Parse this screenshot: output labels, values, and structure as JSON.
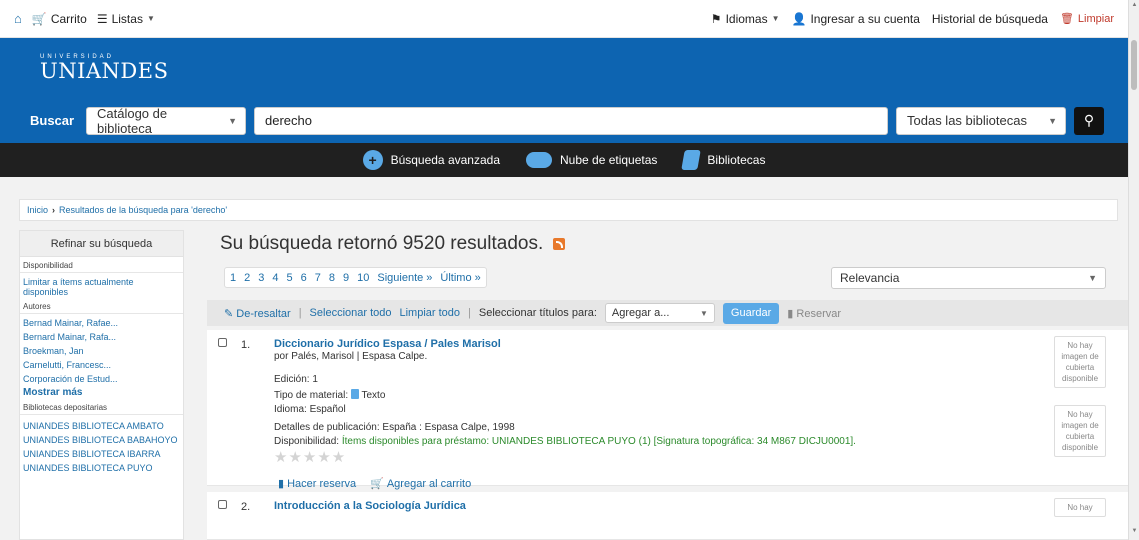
{
  "topbar": {
    "cart": "Carrito",
    "lists": "Listas",
    "languages": "Idiomas",
    "login": "Ingresar a su cuenta",
    "history": "Historial de búsqueda",
    "clear": "Limpiar"
  },
  "header": {
    "logo_top": "UNIVERSIDAD",
    "logo_name": "UNIANDES"
  },
  "search": {
    "label": "Buscar",
    "catalog": "Catálogo de biblioteca",
    "query": "derecho",
    "libraries": "Todas las bibliotecas"
  },
  "blacknav": {
    "advanced": "Búsqueda avanzada",
    "tags": "Nube de etiquetas",
    "libraries": "Bibliotecas"
  },
  "breadcrumb": {
    "home": "Inicio",
    "current": "Resultados de la búsqueda para 'derecho'"
  },
  "sidebar": {
    "title": "Refinar su búsqueda",
    "availability_head": "Disponibilidad",
    "availability_link": "Limitar a ítems actualmente disponibles",
    "authors_head": "Autores",
    "authors": [
      "Bernad Mainar, Rafae...",
      "Bernard Mainar, Rafa...",
      "Broekman, Jan",
      "Carnelutti, Francesc...",
      "Corporación de Estud..."
    ],
    "show_more": "Mostrar más",
    "libraries_head": "Bibliotecas depositarias",
    "libraries": [
      "UNIANDES BIBLIOTECA AMBATO",
      "UNIANDES BIBLIOTECA BABAHOYO",
      "UNIANDES BIBLIOTECA IBARRA",
      "UNIANDES BIBLIOTECA PUYO"
    ]
  },
  "main": {
    "title": "Su búsqueda retornó 9520 resultados.",
    "pages": [
      "1",
      "2",
      "3",
      "4",
      "5",
      "6",
      "7",
      "8",
      "9",
      "10"
    ],
    "next": "Siguiente »",
    "last": "Último »",
    "sort": "Relevancia"
  },
  "actions": {
    "unhighlight": "De-resaltar",
    "select_all": "Seleccionar todo",
    "clear_all": "Limpiar todo",
    "select_titles": "Seleccionar títulos para:",
    "add_to": "Agregar a...",
    "save": "Guardar",
    "reserve": "Reservar"
  },
  "results": [
    {
      "num": "1.",
      "title": "Diccionario Jurídico Espasa / Pales Marisol",
      "by": "por Palés, Marisol | Espasa Calpe.",
      "edition": "Edición: 1",
      "material_label": "Tipo de material:",
      "material": "Texto",
      "language": "Idioma: Español",
      "pub_label": "Detalles de publicación:",
      "pub": "España : Espasa Calpe, 1998",
      "avail_label": "Disponibilidad:",
      "avail_green": "Ítems disponibles para préstamo:",
      "avail_rest": "UNIANDES BIBLIOTECA PUYO (1) [Signatura topográfica: 34 M867 DICJU0001].",
      "stars": "★★★★★",
      "hold": "Hacer reserva",
      "cart": "Agregar al carrito",
      "nocover": "No hay imagen de cubierta disponible"
    },
    {
      "num": "2.",
      "title": "Introducción a la Sociología Jurídica",
      "nocover": "No hay"
    }
  ]
}
